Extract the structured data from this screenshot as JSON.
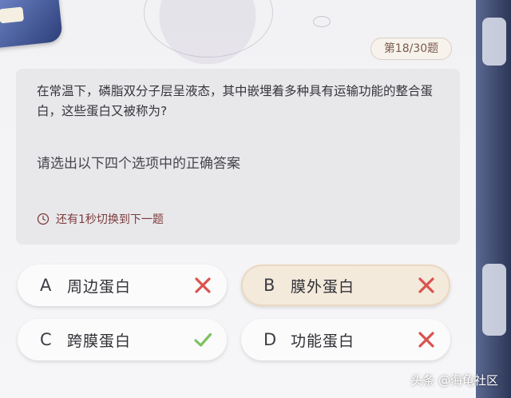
{
  "header": {
    "counter": "第18/30题"
  },
  "question": {
    "text": "在常温下，磷脂双分子层呈液态，其中嵌埋着多种具有运输功能的整合蛋白，这些蛋白又被称为?",
    "instruction": "请选出以下四个选项中的正确答案",
    "timer_text": "还有1秒切换到下一题"
  },
  "options": [
    {
      "letter": "A",
      "text": "周边蛋白",
      "result": "wrong",
      "mark_icon": "cross-icon"
    },
    {
      "letter": "B",
      "text": "膜外蛋白",
      "result": "wrong",
      "mark_icon": "cross-icon",
      "selected": true
    },
    {
      "letter": "C",
      "text": "跨膜蛋白",
      "result": "correct",
      "mark_icon": "check-icon"
    },
    {
      "letter": "D",
      "text": "功能蛋白",
      "result": "wrong",
      "mark_icon": "cross-icon"
    }
  ],
  "colors": {
    "correct": "#7cc25f",
    "wrong": "#d9534f",
    "timer": "#7d3c3c"
  },
  "watermark": "头条 @海龟社区"
}
